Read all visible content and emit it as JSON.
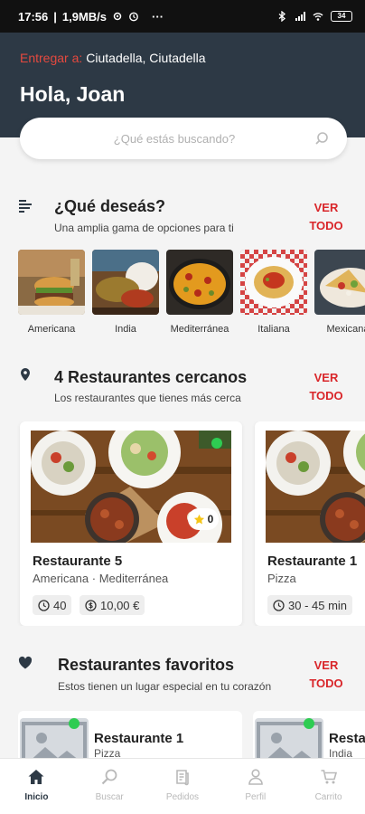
{
  "status_bar": {
    "time": "17:56",
    "speed": "1,9MB/s",
    "more": "···",
    "battery": "34"
  },
  "header": {
    "deliver_label": "Entregar a:",
    "location": "Ciutadella, Ciutadella",
    "greeting": "Hola, Joan"
  },
  "search": {
    "placeholder": "¿Qué estás buscando?"
  },
  "categories_section": {
    "title": "¿Qué deseás?",
    "subtitle": "Una amplia gama de opciones para ti",
    "see_all_1": "VER",
    "see_all_2": "TODO",
    "items": [
      {
        "label": "Americana"
      },
      {
        "label": "India"
      },
      {
        "label": "Mediterránea"
      },
      {
        "label": "Italiana"
      },
      {
        "label": "Mexicana"
      }
    ]
  },
  "nearby_section": {
    "title": "4 Restaurantes cercanos",
    "subtitle": "Los restaurantes que tienes más cerca",
    "see_all_1": "VER",
    "see_all_2": "TODO",
    "restaurants": [
      {
        "name": "Restaurante 5",
        "cuisine": "Americana · Mediterránea",
        "time": "40",
        "price": "10,00 €",
        "rating": "0",
        "open": true
      },
      {
        "name": "Restaurante 1",
        "cuisine": "Pizza",
        "time": "30 - 45 min"
      }
    ]
  },
  "favorites_section": {
    "title": "Restaurantes favoritos",
    "subtitle": "Estos tienen un lugar especial en tu corazón",
    "see_all_1": "VER",
    "see_all_2": "TODO",
    "restaurants": [
      {
        "name": "Restaurante 1",
        "cuisine": "Pizza"
      },
      {
        "name": "Resta",
        "cuisine": "India"
      }
    ]
  },
  "bottom_nav": [
    {
      "label": "Inicio",
      "icon": "home-icon",
      "active": true
    },
    {
      "label": "Buscar",
      "icon": "search-icon"
    },
    {
      "label": "Pedidos",
      "icon": "orders-icon"
    },
    {
      "label": "Perfil",
      "icon": "user-icon"
    },
    {
      "label": "Carrito",
      "icon": "cart-icon"
    }
  ],
  "colors": {
    "header_bg": "#2d3945",
    "accent_red": "#d9262a",
    "deliver_label": "#e5493f",
    "open_green": "#2ecc52"
  }
}
